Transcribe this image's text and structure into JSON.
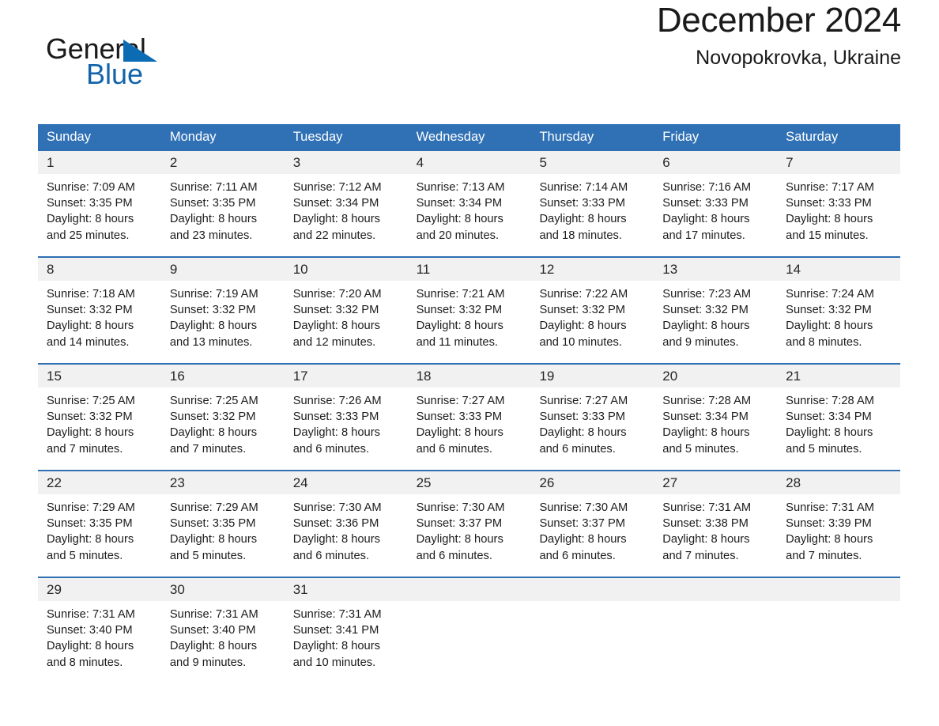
{
  "brand": {
    "name_part1": "General",
    "name_part2": "Blue",
    "triangle_color": "#0b6cb4",
    "blue_color": "#1464ab",
    "logo_icon": "triangle-icon"
  },
  "header": {
    "month_title": "December 2024",
    "location": "Novopokrovka, Ukraine"
  },
  "theme": {
    "header_blue": "#3071b5",
    "row_border_blue": "#2f6fb2",
    "daynum_band": "#f1f1f1",
    "text_color": "#1c1c1c",
    "page_background": "#ffffff"
  },
  "weekdays": [
    "Sunday",
    "Monday",
    "Tuesday",
    "Wednesday",
    "Thursday",
    "Friday",
    "Saturday"
  ],
  "weeks": [
    [
      {
        "day": "1",
        "sunrise": "Sunrise: 7:09 AM",
        "sunset": "Sunset: 3:35 PM",
        "daylight_line1": "Daylight: 8 hours",
        "daylight_line2": "and 25 minutes."
      },
      {
        "day": "2",
        "sunrise": "Sunrise: 7:11 AM",
        "sunset": "Sunset: 3:35 PM",
        "daylight_line1": "Daylight: 8 hours",
        "daylight_line2": "and 23 minutes."
      },
      {
        "day": "3",
        "sunrise": "Sunrise: 7:12 AM",
        "sunset": "Sunset: 3:34 PM",
        "daylight_line1": "Daylight: 8 hours",
        "daylight_line2": "and 22 minutes."
      },
      {
        "day": "4",
        "sunrise": "Sunrise: 7:13 AM",
        "sunset": "Sunset: 3:34 PM",
        "daylight_line1": "Daylight: 8 hours",
        "daylight_line2": "and 20 minutes."
      },
      {
        "day": "5",
        "sunrise": "Sunrise: 7:14 AM",
        "sunset": "Sunset: 3:33 PM",
        "daylight_line1": "Daylight: 8 hours",
        "daylight_line2": "and 18 minutes."
      },
      {
        "day": "6",
        "sunrise": "Sunrise: 7:16 AM",
        "sunset": "Sunset: 3:33 PM",
        "daylight_line1": "Daylight: 8 hours",
        "daylight_line2": "and 17 minutes."
      },
      {
        "day": "7",
        "sunrise": "Sunrise: 7:17 AM",
        "sunset": "Sunset: 3:33 PM",
        "daylight_line1": "Daylight: 8 hours",
        "daylight_line2": "and 15 minutes."
      }
    ],
    [
      {
        "day": "8",
        "sunrise": "Sunrise: 7:18 AM",
        "sunset": "Sunset: 3:32 PM",
        "daylight_line1": "Daylight: 8 hours",
        "daylight_line2": "and 14 minutes."
      },
      {
        "day": "9",
        "sunrise": "Sunrise: 7:19 AM",
        "sunset": "Sunset: 3:32 PM",
        "daylight_line1": "Daylight: 8 hours",
        "daylight_line2": "and 13 minutes."
      },
      {
        "day": "10",
        "sunrise": "Sunrise: 7:20 AM",
        "sunset": "Sunset: 3:32 PM",
        "daylight_line1": "Daylight: 8 hours",
        "daylight_line2": "and 12 minutes."
      },
      {
        "day": "11",
        "sunrise": "Sunrise: 7:21 AM",
        "sunset": "Sunset: 3:32 PM",
        "daylight_line1": "Daylight: 8 hours",
        "daylight_line2": "and 11 minutes."
      },
      {
        "day": "12",
        "sunrise": "Sunrise: 7:22 AM",
        "sunset": "Sunset: 3:32 PM",
        "daylight_line1": "Daylight: 8 hours",
        "daylight_line2": "and 10 minutes."
      },
      {
        "day": "13",
        "sunrise": "Sunrise: 7:23 AM",
        "sunset": "Sunset: 3:32 PM",
        "daylight_line1": "Daylight: 8 hours",
        "daylight_line2": "and 9 minutes."
      },
      {
        "day": "14",
        "sunrise": "Sunrise: 7:24 AM",
        "sunset": "Sunset: 3:32 PM",
        "daylight_line1": "Daylight: 8 hours",
        "daylight_line2": "and 8 minutes."
      }
    ],
    [
      {
        "day": "15",
        "sunrise": "Sunrise: 7:25 AM",
        "sunset": "Sunset: 3:32 PM",
        "daylight_line1": "Daylight: 8 hours",
        "daylight_line2": "and 7 minutes."
      },
      {
        "day": "16",
        "sunrise": "Sunrise: 7:25 AM",
        "sunset": "Sunset: 3:32 PM",
        "daylight_line1": "Daylight: 8 hours",
        "daylight_line2": "and 7 minutes."
      },
      {
        "day": "17",
        "sunrise": "Sunrise: 7:26 AM",
        "sunset": "Sunset: 3:33 PM",
        "daylight_line1": "Daylight: 8 hours",
        "daylight_line2": "and 6 minutes."
      },
      {
        "day": "18",
        "sunrise": "Sunrise: 7:27 AM",
        "sunset": "Sunset: 3:33 PM",
        "daylight_line1": "Daylight: 8 hours",
        "daylight_line2": "and 6 minutes."
      },
      {
        "day": "19",
        "sunrise": "Sunrise: 7:27 AM",
        "sunset": "Sunset: 3:33 PM",
        "daylight_line1": "Daylight: 8 hours",
        "daylight_line2": "and 6 minutes."
      },
      {
        "day": "20",
        "sunrise": "Sunrise: 7:28 AM",
        "sunset": "Sunset: 3:34 PM",
        "daylight_line1": "Daylight: 8 hours",
        "daylight_line2": "and 5 minutes."
      },
      {
        "day": "21",
        "sunrise": "Sunrise: 7:28 AM",
        "sunset": "Sunset: 3:34 PM",
        "daylight_line1": "Daylight: 8 hours",
        "daylight_line2": "and 5 minutes."
      }
    ],
    [
      {
        "day": "22",
        "sunrise": "Sunrise: 7:29 AM",
        "sunset": "Sunset: 3:35 PM",
        "daylight_line1": "Daylight: 8 hours",
        "daylight_line2": "and 5 minutes."
      },
      {
        "day": "23",
        "sunrise": "Sunrise: 7:29 AM",
        "sunset": "Sunset: 3:35 PM",
        "daylight_line1": "Daylight: 8 hours",
        "daylight_line2": "and 5 minutes."
      },
      {
        "day": "24",
        "sunrise": "Sunrise: 7:30 AM",
        "sunset": "Sunset: 3:36 PM",
        "daylight_line1": "Daylight: 8 hours",
        "daylight_line2": "and 6 minutes."
      },
      {
        "day": "25",
        "sunrise": "Sunrise: 7:30 AM",
        "sunset": "Sunset: 3:37 PM",
        "daylight_line1": "Daylight: 8 hours",
        "daylight_line2": "and 6 minutes."
      },
      {
        "day": "26",
        "sunrise": "Sunrise: 7:30 AM",
        "sunset": "Sunset: 3:37 PM",
        "daylight_line1": "Daylight: 8 hours",
        "daylight_line2": "and 6 minutes."
      },
      {
        "day": "27",
        "sunrise": "Sunrise: 7:31 AM",
        "sunset": "Sunset: 3:38 PM",
        "daylight_line1": "Daylight: 8 hours",
        "daylight_line2": "and 7 minutes."
      },
      {
        "day": "28",
        "sunrise": "Sunrise: 7:31 AM",
        "sunset": "Sunset: 3:39 PM",
        "daylight_line1": "Daylight: 8 hours",
        "daylight_line2": "and 7 minutes."
      }
    ],
    [
      {
        "day": "29",
        "sunrise": "Sunrise: 7:31 AM",
        "sunset": "Sunset: 3:40 PM",
        "daylight_line1": "Daylight: 8 hours",
        "daylight_line2": "and 8 minutes."
      },
      {
        "day": "30",
        "sunrise": "Sunrise: 7:31 AM",
        "sunset": "Sunset: 3:40 PM",
        "daylight_line1": "Daylight: 8 hours",
        "daylight_line2": "and 9 minutes."
      },
      {
        "day": "31",
        "sunrise": "Sunrise: 7:31 AM",
        "sunset": "Sunset: 3:41 PM",
        "daylight_line1": "Daylight: 8 hours",
        "daylight_line2": "and 10 minutes."
      },
      {
        "day": "",
        "sunrise": "",
        "sunset": "",
        "daylight_line1": "",
        "daylight_line2": ""
      },
      {
        "day": "",
        "sunrise": "",
        "sunset": "",
        "daylight_line1": "",
        "daylight_line2": ""
      },
      {
        "day": "",
        "sunrise": "",
        "sunset": "",
        "daylight_line1": "",
        "daylight_line2": ""
      },
      {
        "day": "",
        "sunrise": "",
        "sunset": "",
        "daylight_line1": "",
        "daylight_line2": ""
      }
    ]
  ]
}
